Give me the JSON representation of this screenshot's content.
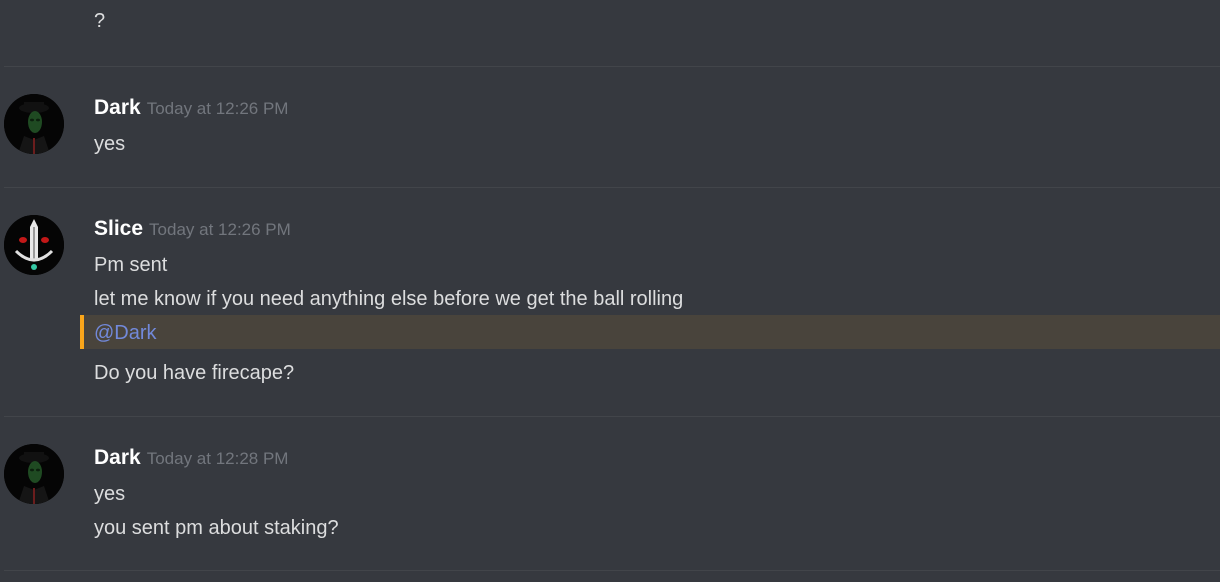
{
  "messages": [
    {
      "lines": [
        "?"
      ]
    },
    {
      "author": "Dark",
      "timestamp": "Today at 12:26 PM",
      "avatar_icon": "masked-figure-avatar",
      "lines": [
        "yes"
      ]
    },
    {
      "author": "Slice",
      "timestamp": "Today at 12:26 PM",
      "avatar_icon": "sword-face-avatar",
      "lines": [
        "Pm sent",
        "let me know if you need anything else before we get the ball rolling"
      ],
      "mention": "@Dark",
      "after_mention": "Do you have firecape?"
    },
    {
      "author": "Dark",
      "timestamp": "Today at 12:28 PM",
      "avatar_icon": "masked-figure-avatar",
      "lines": [
        "yes",
        "you sent pm about staking?"
      ]
    }
  ],
  "colors": {
    "background": "#36393f",
    "text": "#dcddde",
    "username": "#ffffff",
    "timestamp": "#72767d",
    "mention": "#7289da",
    "mention_highlight": "#49443c",
    "mention_bar": "#faa61a"
  }
}
